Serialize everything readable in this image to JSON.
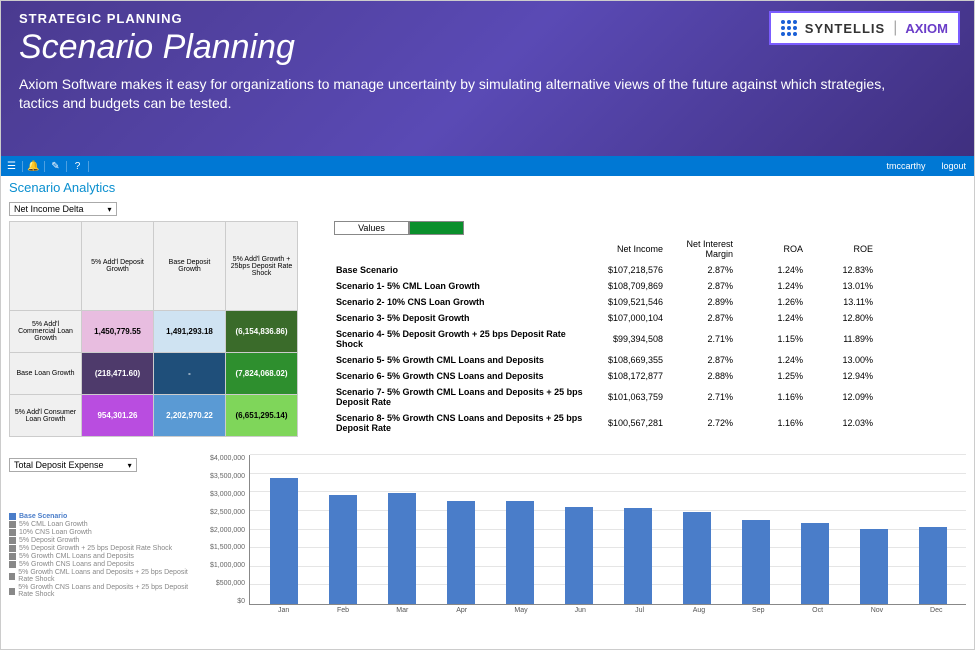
{
  "banner": {
    "sub": "STRATEGIC PLANNING",
    "title": "Scenario Planning",
    "desc": "Axiom Software makes it easy for organizations to manage uncertainty by simulating alternative views of the future against which strategies, tactics and budgets can be tested.",
    "logo1": "SYNTELLIS",
    "logo2": "AXIOM"
  },
  "toolbar": {
    "user": "tmccarthy",
    "logout": "logout"
  },
  "page_title": "Scenario Analytics",
  "selector1": "Net Income Delta",
  "values_label": "Values",
  "heatmap": {
    "cols": [
      "5% Add'l Deposit Growth",
      "Base Deposit Growth",
      "5% Add'l Growth + 25bps Deposit Rate Shock"
    ],
    "rows": [
      "5% Add'l Commercial Loan Growth",
      "Base Loan Growth",
      "5% Add'l Consumer Loan Growth"
    ],
    "cells": [
      [
        {
          "v": "1,450,779.55",
          "c": "#e8bde0"
        },
        {
          "v": "1,491,293.18",
          "c": "#cfe3f2"
        },
        {
          "v": "(6,154,836.86)",
          "c": "#3a6b2a",
          "t": "#fff"
        }
      ],
      [
        {
          "v": "(218,471.60)",
          "c": "#4e3a6b",
          "t": "#fff"
        },
        {
          "v": "-",
          "c": "#1f4f7a",
          "t": "#fff"
        },
        {
          "v": "(7,824,068.02)",
          "c": "#2e8f2e",
          "t": "#fff"
        }
      ],
      [
        {
          "v": "954,301.26",
          "c": "#b94de0",
          "t": "#fff"
        },
        {
          "v": "2,202,970.22",
          "c": "#5a9ad4",
          "t": "#fff"
        },
        {
          "v": "(6,651,295.14)",
          "c": "#7fd65a"
        }
      ]
    ]
  },
  "scenarios": {
    "headers": [
      "",
      "Net Income",
      "Net Interest Margin",
      "ROA",
      "ROE"
    ],
    "rows": [
      [
        "Base Scenario",
        "$107,218,576",
        "2.87%",
        "1.24%",
        "12.83%"
      ],
      [
        "Scenario 1- 5% CML Loan Growth",
        "$108,709,869",
        "2.87%",
        "1.24%",
        "13.01%"
      ],
      [
        "Scenario 2- 10% CNS Loan Growth",
        "$109,521,546",
        "2.89%",
        "1.26%",
        "13.11%"
      ],
      [
        "Scenario 3- 5% Deposit Growth",
        "$107,000,104",
        "2.87%",
        "1.24%",
        "12.80%"
      ],
      [
        "Scenario 4- 5% Deposit Growth + 25 bps Deposit Rate Shock",
        "$99,394,508",
        "2.71%",
        "1.15%",
        "11.89%"
      ],
      [
        "Scenario 5- 5% Growth CML Loans and Deposits",
        "$108,669,355",
        "2.87%",
        "1.24%",
        "13.00%"
      ],
      [
        "Scenario 6- 5% Growth CNS Loans and Deposits",
        "$108,172,877",
        "2.88%",
        "1.25%",
        "12.94%"
      ],
      [
        "Scenario 7- 5% Growth CML Loans and Deposits + 25 bps Deposit Rate",
        "$101,063,759",
        "2.71%",
        "1.16%",
        "12.09%"
      ],
      [
        "Scenario 8- 5% Growth CNS Loans and Deposits + 25 bps Deposit Rate",
        "$100,567,281",
        "2.72%",
        "1.16%",
        "12.03%"
      ]
    ]
  },
  "selector2": "Total Deposit Expense",
  "legend": [
    "Base Scenario",
    "5% CML Loan Growth",
    "10% CNS Loan Growth",
    "5% Deposit Growth",
    "5% Deposit Growth + 25 bps Deposit Rate Shock",
    "5% Growth CML Loans and Deposits",
    "5% Growth CNS Loans and Deposits",
    "5% Growth CML Loans and Deposits + 25 bps Deposit Rate Shock",
    "5% Growth CNS Loans and Deposits + 25 bps Deposit Rate Shock"
  ],
  "chart_data": {
    "type": "bar",
    "title": "",
    "xlabel": "",
    "ylabel": "",
    "ylim": [
      0,
      4000000
    ],
    "yticks": [
      "$4,000,000",
      "$3,500,000",
      "$3,000,000",
      "$2,500,000",
      "$2,000,000",
      "$1,500,000",
      "$1,000,000",
      "$500,000",
      "$0"
    ],
    "categories": [
      "Jan",
      "Feb",
      "Mar",
      "Apr",
      "May",
      "Jun",
      "Jul",
      "Aug",
      "Sep",
      "Oct",
      "Nov",
      "Dec"
    ],
    "values": [
      3350000,
      2900000,
      2950000,
      2750000,
      2750000,
      2600000,
      2550000,
      2450000,
      2250000,
      2150000,
      2000000,
      2050000
    ]
  }
}
